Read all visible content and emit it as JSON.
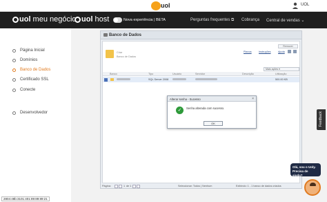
{
  "header": {
    "logo_text": "uol",
    "user_label": "UOL"
  },
  "brandbar": {
    "brand1_bold": "uol",
    "brand1_rest": " meu negócio",
    "brand2_bold": "uol",
    "brand2_rest": " host",
    "toggle_label": "Nova experiência | BETA",
    "nav": {
      "faq": "Perguntas frequentes",
      "billing": "Cobrança",
      "sales": "Central de vendas"
    }
  },
  "sidebar": {
    "items": [
      {
        "label": "Página Inicial"
      },
      {
        "label": "Domínios"
      },
      {
        "label": "Banco de Dados"
      },
      {
        "label": "Certificado SSL"
      },
      {
        "label": "Conecte"
      },
      {
        "label": "Desenvolvedor"
      }
    ]
  },
  "window": {
    "title": "Banco de Dados",
    "top_button": "Remover",
    "enter_label": "Criar",
    "db_label": "Banco de Dados",
    "links": {
      "plans": "Planos",
      "instructions": "Instruções",
      "help": "Ajuda"
    },
    "actions_select": "Mais ações",
    "columns": [
      "Banco",
      "Tipo",
      "Usuário",
      "Servidor",
      "Descrição",
      "Utilização"
    ],
    "rows": [
      {
        "type": "SQL Server 2008",
        "usage": "500.00 KB"
      }
    ],
    "footer": {
      "page_label": "Página:",
      "page_of": "de 1",
      "selection": "Seleccionar: Todos | Nenhum",
      "showing": "Exibindo: 1 - 1 banco de dados criados"
    }
  },
  "dialog": {
    "title": "Alterar senha - Sucesso",
    "message": "Senha alterada com sucesso.",
    "ok_label": "OK",
    "close_glyph": "×"
  },
  "feedback_label": "Feedback",
  "chat": {
    "bubble_line1": "Olá, sou o Uoly.",
    "bubble_line2": "Precisa de ajuda?"
  },
  "ip_label": "2804:48b:3101:401:89:89:89:21"
}
